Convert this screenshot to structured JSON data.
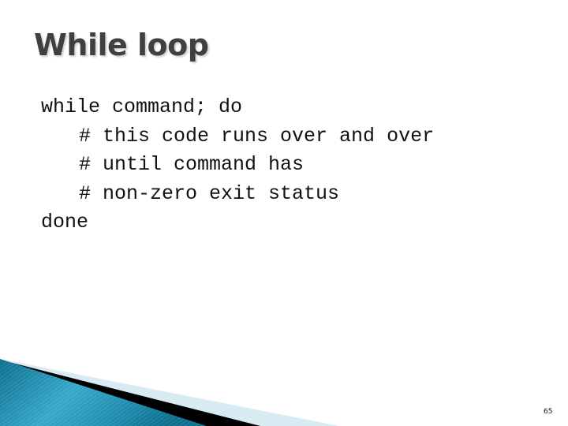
{
  "slide": {
    "title": "While loop",
    "code_lines": [
      "while command; do",
      "# this code runs over and over",
      "# until command has",
      "# non-zero exit status",
      "done"
    ],
    "page_number": "65"
  },
  "colors": {
    "title": "#404040",
    "accent_blue": "#1a8fb0",
    "accent_light": "#d8ebf2"
  }
}
